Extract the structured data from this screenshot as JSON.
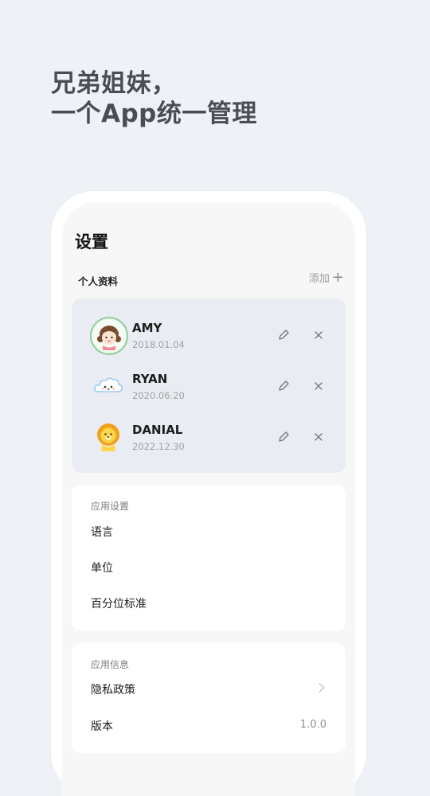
{
  "promo": {
    "line1": "兄弟姐妹，",
    "line2": "一个App统一管理"
  },
  "settings": {
    "title": "设置",
    "profiles_label": "个人资料",
    "add_label": "添加",
    "add_icon": "plus-icon",
    "profiles": [
      {
        "name": "AMY",
        "date": "2018.01.04",
        "avatar": "girl-avatar"
      },
      {
        "name": "RYAN",
        "date": "2020.06.20",
        "avatar": "cloud-avatar"
      },
      {
        "name": "DANIAL",
        "date": "2022.12.30",
        "avatar": "lion-avatar"
      }
    ],
    "app_settings": {
      "title": "应用设置",
      "items": [
        "语言",
        "单位",
        "百分位标准"
      ]
    },
    "app_info": {
      "title": "应用信息",
      "privacy": "隐私政策",
      "version_label": "版本",
      "version_value": "1.0.0"
    }
  },
  "colors": {
    "background": "#eef1f6",
    "profile_card": "#e9edf3",
    "avatar_ring": "#8fcf9d"
  }
}
